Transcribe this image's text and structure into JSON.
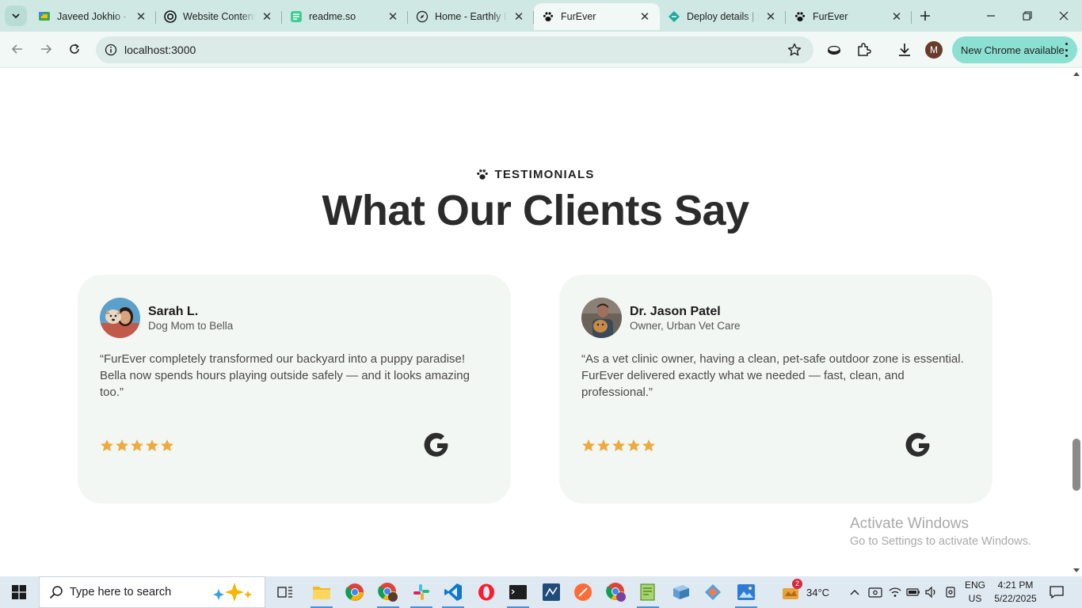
{
  "browser": {
    "tabs": [
      {
        "title": "Javeed Jokhio - Goo",
        "favicon": "google-chat-icon",
        "active": false
      },
      {
        "title": "Website Content",
        "favicon": "chatgpt-icon",
        "active": false
      },
      {
        "title": "readme.so",
        "favicon": "readme-so-icon",
        "active": false
      },
      {
        "title": "Home - Earthly Escape",
        "favicon": "compass-icon",
        "active": false
      },
      {
        "title": "FurEver",
        "favicon": "paw-icon",
        "active": true
      },
      {
        "title": "Deploy details | Netlify",
        "favicon": "netlify-icon",
        "active": false
      },
      {
        "title": "FurEver",
        "favicon": "paw-icon",
        "active": false
      }
    ],
    "address": "localhost:3000",
    "profile_initial": "M",
    "update_chip": "New Chrome available"
  },
  "section": {
    "eyebrow": "TESTIMONIALS",
    "title": "What Our Clients Say"
  },
  "testimonials": [
    {
      "name": "Sarah L.",
      "role": "Dog Mom to Bella",
      "quote": "“FurEver completely transformed our backyard into a puppy paradise! Bella now spends hours playing outside safely — and it looks amazing too.”",
      "rating": 5,
      "source_icon": "google-g-icon"
    },
    {
      "name": "Dr. Jason Patel",
      "role": "Owner, Urban Vet Care",
      "quote": "“As a vet clinic owner, having a clean, pet-safe outdoor zone is essential. FurEver delivered exactly what we needed — fast, clean, and professional.”",
      "rating": 5,
      "source_icon": "google-g-icon"
    }
  ],
  "watermark": {
    "line1": "Activate Windows",
    "line2": "Go to Settings to activate Windows."
  },
  "taskbar": {
    "search_placeholder": "Type here to search",
    "weather": "34°C",
    "weather_badge": "2",
    "lang_line1": "ENG",
    "lang_line2": "US",
    "time": "4:21 PM",
    "date": "5/22/2025"
  },
  "colors": {
    "tab_strip": "#cfe8e3",
    "toolbar": "#f1f8f6",
    "card_bg": "#f2f7f4",
    "star": "#f0a93b",
    "taskbar": "#dfe9f2"
  }
}
